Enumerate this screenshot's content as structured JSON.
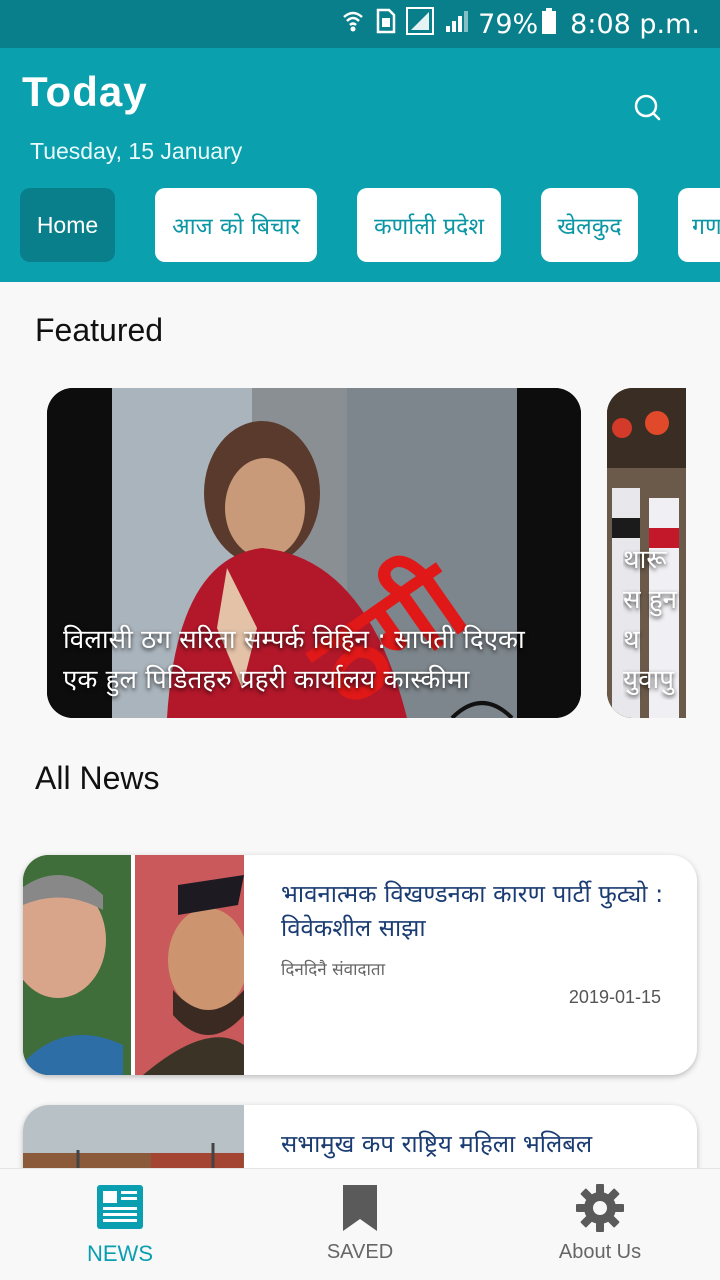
{
  "status_bar": {
    "battery": "79%",
    "time": "8:08 p.m.",
    "icons": [
      "wifi-calling-icon",
      "sim-icon",
      "signal-icon",
      "signal-icon",
      "battery-icon"
    ]
  },
  "header": {
    "title": "Today",
    "date": "Tuesday, 15 January",
    "search_icon": "search-icon"
  },
  "tabs": [
    {
      "label": "Home",
      "active": true
    },
    {
      "label": "आज को बिचार",
      "active": false
    },
    {
      "label": "कर्णाली प्रदेश",
      "active": false
    },
    {
      "label": "खेलकुद",
      "active": false
    },
    {
      "label": "गण",
      "active": false
    }
  ],
  "featured": {
    "heading": "Featured",
    "items": [
      {
        "caption": "विलासी ठग सरिता सम्पर्क विहिन : सापती दिएका एक हुल पिडितहरु प्रहरी कार्यालय कास्कीमा"
      },
      {
        "caption": "थारू स हुन थ युवापु"
      }
    ]
  },
  "all_news": {
    "heading": "All News",
    "items": [
      {
        "headline": "भावनात्मक विखण्डनका कारण पार्टी फुट्यो : विवेकशील साझा",
        "source": "दिनदिनै संवादाता",
        "date": "2019-01-15"
      },
      {
        "headline": "सभामुख कप राष्ट्रिय महिला भलिबल",
        "source": "",
        "date": ""
      }
    ]
  },
  "bottom_nav": [
    {
      "label": "NEWS",
      "icon": "newspaper-icon",
      "active": true
    },
    {
      "label": "SAVED",
      "icon": "bookmark-icon",
      "active": false
    },
    {
      "label": "About Us",
      "icon": "gear-icon",
      "active": false
    }
  ],
  "colors": {
    "status_bar": "#0a7f8c",
    "header": "#0aa0ad",
    "active_tab": "#0a7f8c",
    "headline": "#1a3c72",
    "accent": "#0a9fb0"
  }
}
